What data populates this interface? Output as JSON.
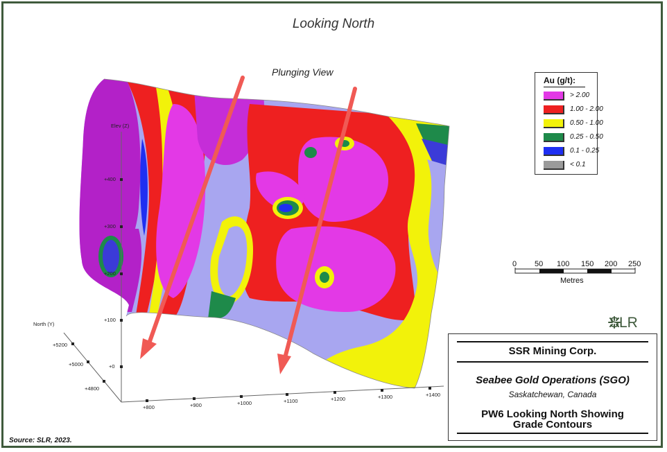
{
  "title": "Looking North",
  "plunging_view_label": "Plunging View",
  "legend": {
    "title": "Au (g/t):",
    "items": [
      {
        "label": "> 2.00",
        "color": "#e339e6"
      },
      {
        "label": "1.00 - 2.00",
        "color": "#ee2020"
      },
      {
        "label": "0.50 - 1.00",
        "color": "#f2f20a"
      },
      {
        "label": "0.25 - 0.50",
        "color": "#1e8a4a"
      },
      {
        "label": "0.1 - 0.25",
        "color": "#1f2ff2"
      },
      {
        "label": "< 0.1",
        "color": "#9a9a9a"
      }
    ]
  },
  "scale_bar": {
    "ticks": [
      "0",
      "50",
      "100",
      "150",
      "200",
      "250"
    ],
    "unit": "Metres"
  },
  "axes": {
    "vertical_title": "Elev (Z)",
    "vertical_ticks": [
      "+400",
      "+300",
      "+200",
      "+100",
      "+0"
    ],
    "north_title": "North (Y)",
    "north_ticks": [
      "+5200",
      "+5000",
      "+4800"
    ],
    "east_ticks": [
      "+800",
      "+900",
      "+1000",
      "+1100",
      "+1200",
      "+1300",
      "+1400"
    ]
  },
  "logo": "SLR",
  "title_block": {
    "company": "SSR Mining Corp.",
    "project": "Seabee Gold Operations (SGO)",
    "location": "Saskatchewan, Canada",
    "figure_title_1": "PW6 Looking North Showing",
    "figure_title_2": "Grade Contours"
  },
  "source": "Source:  SLR, 2023.",
  "colors": {
    "frame": "#3f5a3c",
    "arrow": "#f05a55",
    "background_grade": "#a4a2f0"
  }
}
